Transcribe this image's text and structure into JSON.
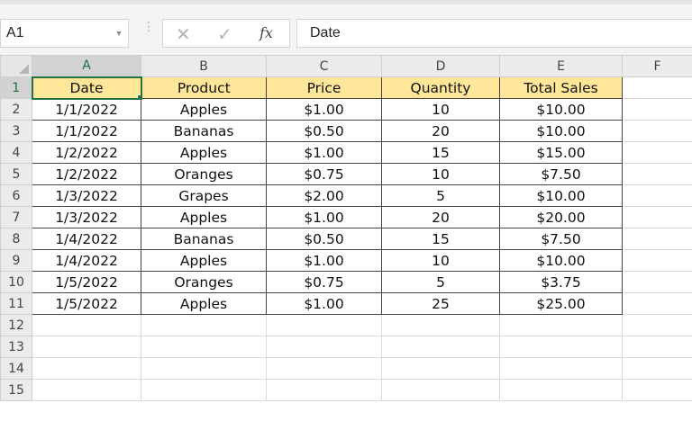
{
  "formula_bar": {
    "name_box": "A1",
    "formula": "Date",
    "fx_label": "fx"
  },
  "sheet": {
    "columns": [
      "A",
      "B",
      "C",
      "D",
      "E",
      "F"
    ],
    "selected_column": "A",
    "selected_row": 1,
    "row_numbers": [
      1,
      2,
      3,
      4,
      5,
      6,
      7,
      8,
      9,
      10,
      11,
      12,
      13,
      14,
      15
    ],
    "header": [
      "Date",
      "Product",
      "Price",
      "Quantity",
      "Total Sales"
    ],
    "rows": [
      [
        "1/1/2022",
        "Apples",
        "$1.00",
        "10",
        "$10.00"
      ],
      [
        "1/1/2022",
        "Bananas",
        "$0.50",
        "20",
        "$10.00"
      ],
      [
        "1/2/2022",
        "Apples",
        "$1.00",
        "15",
        "$15.00"
      ],
      [
        "1/2/2022",
        "Oranges",
        "$0.75",
        "10",
        "$7.50"
      ],
      [
        "1/3/2022",
        "Grapes",
        "$2.00",
        "5",
        "$10.00"
      ],
      [
        "1/3/2022",
        "Apples",
        "$1.00",
        "20",
        "$20.00"
      ],
      [
        "1/4/2022",
        "Bananas",
        "$0.50",
        "15",
        "$7.50"
      ],
      [
        "1/4/2022",
        "Apples",
        "$1.00",
        "10",
        "$10.00"
      ],
      [
        "1/5/2022",
        "Oranges",
        "$0.75",
        "5",
        "$3.75"
      ],
      [
        "1/5/2022",
        "Apples",
        "$1.00",
        "25",
        "$25.00"
      ]
    ]
  },
  "colors": {
    "header_fill": "#ffe699",
    "selection_accent": "#217346"
  }
}
